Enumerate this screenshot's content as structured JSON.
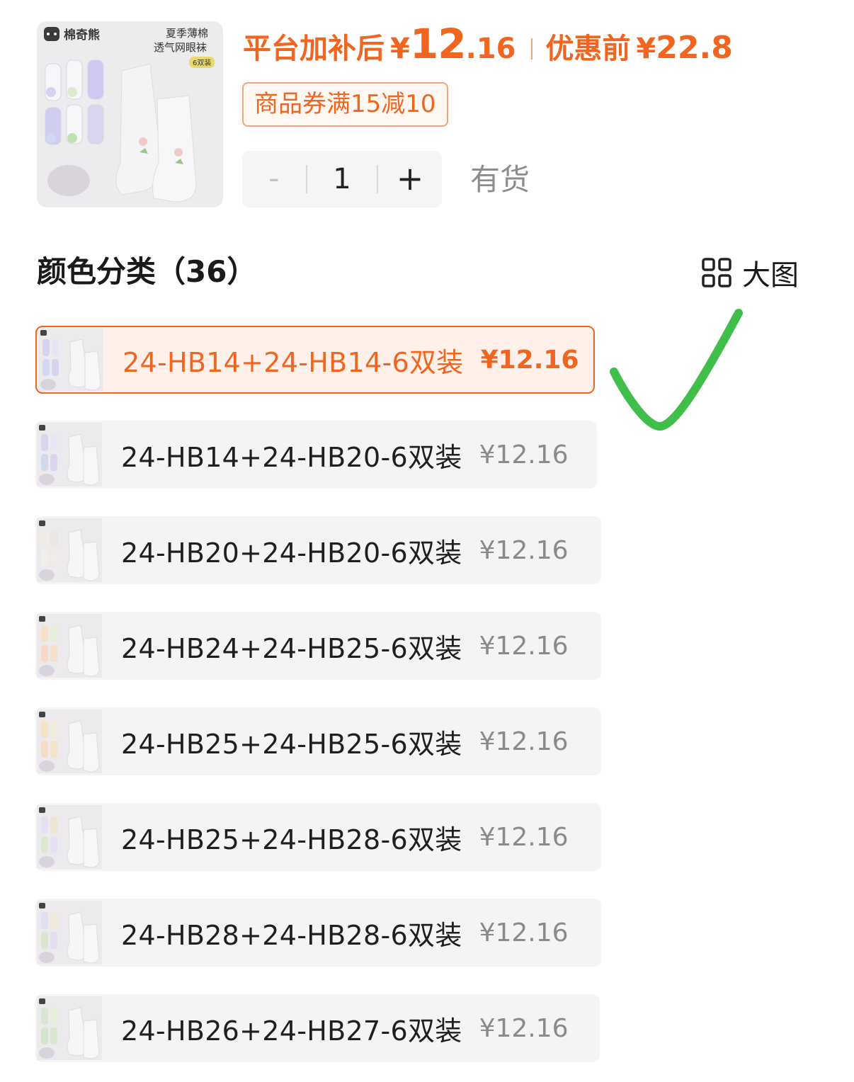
{
  "product": {
    "image_text": {
      "brand": "棉奇熊",
      "line1": "夏季薄棉",
      "line2": "透气网眼袜",
      "badge": "6双装"
    },
    "price_label": "平台加补后",
    "price_currency": "¥",
    "price_int": "12",
    "price_dec": ".16",
    "orig_label": "优惠前",
    "orig_currency": "¥",
    "orig_value": "22.8",
    "coupon": "商品券满15减10",
    "qty_minus": "-",
    "qty_value": "1",
    "qty_plus": "+",
    "stock": "有货"
  },
  "section": {
    "title": "颜色分类（36）",
    "big_view_label": "大图",
    "big_view_icon": "grid-icon"
  },
  "options": [
    {
      "name": "24-HB14+24-HB14-6双装",
      "price": "¥12.16",
      "selected": true
    },
    {
      "name": "24-HB14+24-HB20-6双装",
      "price": "¥12.16",
      "selected": false
    },
    {
      "name": "24-HB20+24-HB20-6双装",
      "price": "¥12.16",
      "selected": false
    },
    {
      "name": "24-HB24+24-HB25-6双装",
      "price": "¥12.16",
      "selected": false
    },
    {
      "name": "24-HB25+24-HB25-6双装",
      "price": "¥12.16",
      "selected": false
    },
    {
      "name": "24-HB25+24-HB28-6双装",
      "price": "¥12.16",
      "selected": false
    },
    {
      "name": "24-HB28+24-HB28-6双装",
      "price": "¥12.16",
      "selected": false
    },
    {
      "name": "24-HB26+24-HB27-6双装",
      "price": "¥12.16",
      "selected": false
    }
  ],
  "colors": {
    "accent": "#f0651f",
    "selected_bg": "#fff1ea",
    "option_bg": "#f4f4f4",
    "muted_text": "#8a8a8a",
    "annotation_check": "#3fbf4a"
  }
}
